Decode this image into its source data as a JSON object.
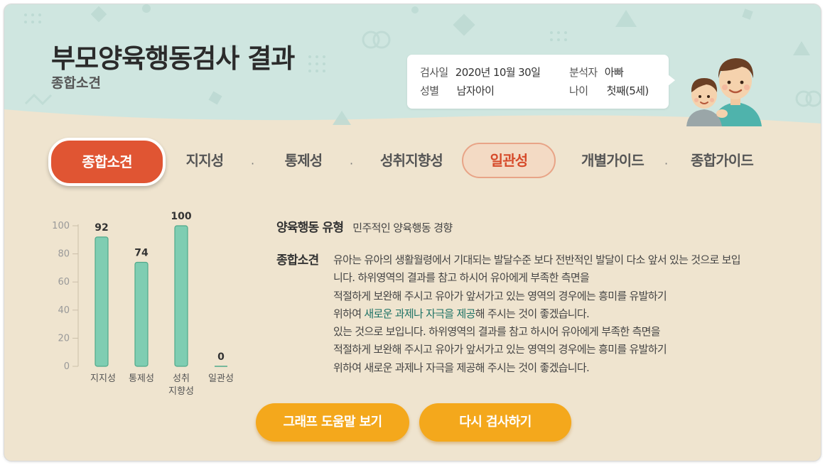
{
  "header": {
    "title": "부모양육행동검사 결과",
    "subtitle": "종합소견"
  },
  "info": {
    "date_label": "검사일",
    "date_value": "2020년 10월 30일",
    "analyst_label": "분석자",
    "analyst_value": "아빠",
    "gender_label": "성별",
    "gender_value": "남자아이",
    "age_label": "나이",
    "age_value": "첫째(5세)"
  },
  "tabs": [
    {
      "label": "종합소견",
      "state": "active"
    },
    {
      "label": "지지성"
    },
    {
      "label": "통제성"
    },
    {
      "label": "성취지향성"
    },
    {
      "label": "일관성",
      "state": "outlined"
    },
    {
      "label": "개별가이드"
    },
    {
      "label": "종합가이드"
    }
  ],
  "tab_separator": "·",
  "chart_data": {
    "type": "bar",
    "categories": [
      "지지성",
      "통제성",
      "성취\n지향성",
      "일관성"
    ],
    "values": [
      92,
      74,
      100,
      0
    ],
    "ylim": [
      0,
      100
    ],
    "yticks": [
      0,
      20,
      40,
      60,
      80,
      100
    ],
    "grid": false,
    "colors": {
      "bar": "#7fcdb2",
      "bar_edge": "#4fa98a",
      "axis": "#cbbfa8",
      "tick": "#999999"
    }
  },
  "content": {
    "type_label": "양육행동 유형",
    "type_value": "민주적인 양육행동 경향",
    "summary_label": "종합소견",
    "summary_lines": [
      "유아는 유아의 생활월령에서 기대되는 발달수준 보다 전반적인 발달이 다소 앞서 있는 것으로 보입",
      "니다. 하위영역의 결과를 참고 하시어 유아에게 부족한 측면을",
      "적절하게 보완해 주시고 유아가 앞서가고 있는 영역의 경우에는 흥미를 유발하기",
      {
        "pre": "위하여 ",
        "highlight": "새로운 과제나 자극을 제공",
        "post": "해 주시는 것이 좋겠습니다."
      },
      "있는 것으로 보입니다. 하위영역의 결과를 참고 하시어 유아에게 부족한 측면을",
      "적절하게 보완해 주시고 유아가 앞서가고 있는 영역의 경우에는 흥미를 유발하기",
      "위하여 새로운 과제나 자극을 제공해 주시는 것이 좋겠습니다."
    ]
  },
  "buttons": {
    "graph_help": "그래프 도움말 보기",
    "retest": "다시 검사하기"
  },
  "colors": {
    "accent": "#e05533",
    "button": "#f4a81c",
    "header_bg": "#cfe6e0",
    "body_bg": "#efe4cf",
    "highlight_text": "#1d7265"
  }
}
